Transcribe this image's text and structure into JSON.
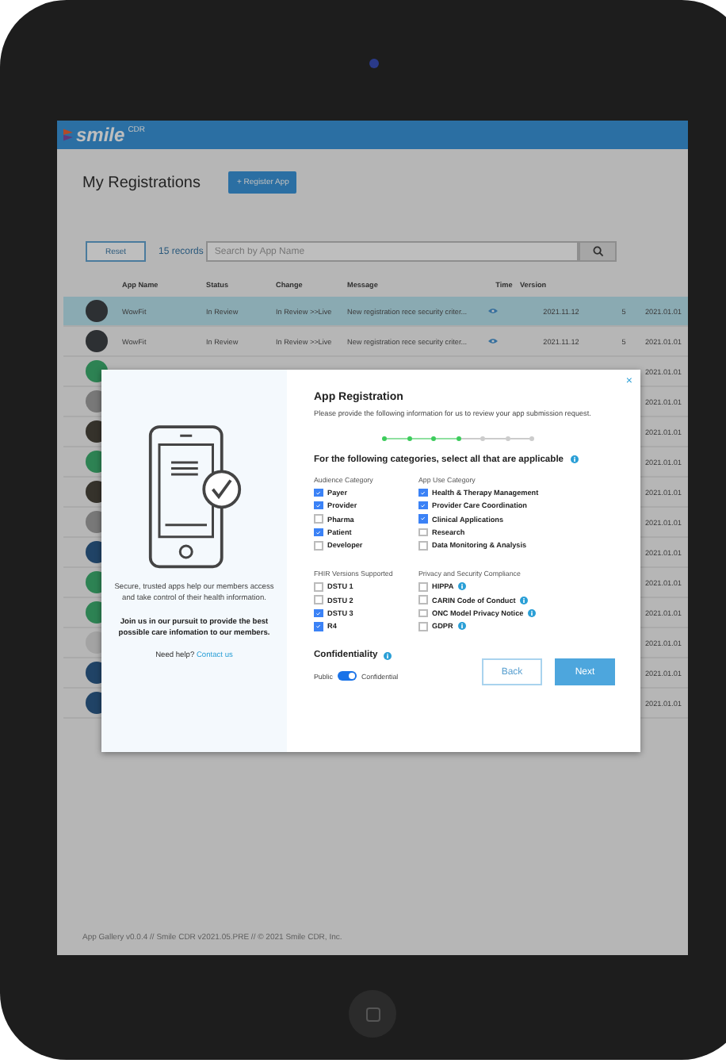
{
  "header": {
    "logo": "smile",
    "logo_suffix": "CDR"
  },
  "page": {
    "title": "My Registrations",
    "register_button": "+ Register App"
  },
  "filter": {
    "reset": "Reset",
    "count": "15 records",
    "search": {
      "placeholder": "Search by App Name"
    }
  },
  "table": {
    "columns": [
      "App Name",
      "Status",
      "Change",
      "Message",
      "Time",
      "Version"
    ],
    "rows": [
      {
        "color": "#2d3033",
        "name": "WowFit",
        "status": "In Review",
        "change": "In Review >>Live",
        "message": "New registration rece security criter...",
        "time": "2021.11.12",
        "version": "5",
        "column_7": "2021.01.01",
        "selected": true
      },
      {
        "color": "#2d3033",
        "name": "WowFit",
        "status": "In Review",
        "change": "In Review >>Live",
        "message": "New registration rece security criter...",
        "time": "2021.11.12",
        "version": "5",
        "column_7": "2021.01.01",
        "selected": false
      },
      {
        "color": "#2d8253",
        "column_7": "2021.01.01",
        "selected": false
      },
      {
        "color": "#787878",
        "column_7": "2021.01.01",
        "selected": false
      },
      {
        "color": "#35322b",
        "column_7": "2021.01.01",
        "selected": false
      },
      {
        "color": "#2d8253",
        "column_7": "2021.01.01",
        "selected": false
      },
      {
        "color": "#35322b",
        "column_7": "2021.01.01",
        "selected": false
      },
      {
        "color": "#787878",
        "column_7": "2021.01.01",
        "selected": false
      },
      {
        "color": "#204366",
        "column_7": "2021.01.01",
        "selected": false
      },
      {
        "color": "#2d8253",
        "column_7": "2021.01.01",
        "selected": false
      },
      {
        "color": "#2d8253",
        "column_7": "2021.01.01",
        "selected": false
      },
      {
        "color": "#a3a3a3",
        "column_7": "2021.01.01",
        "selected": false
      },
      {
        "color": "#204366",
        "column_7": "2021.01.01",
        "selected": false
      },
      {
        "color": "#204366",
        "column_7": "2021.01.01",
        "selected": false
      }
    ]
  },
  "footer": "App Gallery v0.0.4 // Smile CDR v2021.05.PRE // © 2021 Smile CDR, Inc.",
  "dialog": {
    "close": "×",
    "side": {
      "text": "Secure, trusted apps help our members access and take control of their health information.",
      "bold_text": "Join us in our pursuit to provide the best possible care infomation to our members.",
      "help": "Need help?",
      "link": "Contact us"
    },
    "title": "App Registration",
    "intro": "Please provide the following information for us to review your app submission request.",
    "steps": [
      {
        "done": true
      },
      {
        "done": true
      },
      {
        "done": true
      },
      {
        "done": true
      },
      {
        "done": false
      },
      {
        "done": false
      },
      {
        "done": false
      }
    ],
    "section_title": "For the following categories, select all that are applicable",
    "groups": [
      {
        "title": "Audience Category",
        "options": [
          {
            "label": "Payer",
            "checked": true,
            "info": false
          },
          {
            "label": "Provider",
            "checked": true,
            "info": false
          },
          {
            "label": "Pharma",
            "checked": false,
            "info": false
          },
          {
            "label": "Patient",
            "checked": true,
            "info": false
          },
          {
            "label": "Developer",
            "checked": false,
            "info": false
          }
        ]
      },
      {
        "title": "App Use Category",
        "options": [
          {
            "label": "Health & Therapy Management",
            "checked": true,
            "info": false
          },
          {
            "label": "Provider Care Coordination",
            "checked": true,
            "info": false
          },
          {
            "label": "Clinical Applications",
            "checked": true,
            "info": false
          },
          {
            "label": "Research",
            "checked": false,
            "info": false
          },
          {
            "label": "Data Monitoring & Analysis",
            "checked": false,
            "info": false
          }
        ]
      },
      {
        "title": "FHIR Versions Supported",
        "options": [
          {
            "label": "DSTU 1",
            "checked": false,
            "info": false
          },
          {
            "label": "DSTU 2",
            "checked": false,
            "info": false
          },
          {
            "label": "DSTU 3",
            "checked": true,
            "info": false
          },
          {
            "label": "R4",
            "checked": true,
            "info": false
          }
        ]
      },
      {
        "title": "Privacy and Security Compliance",
        "options": [
          {
            "label": "HIPPA",
            "checked": false,
            "info": true
          },
          {
            "label": "CARIN Code of Conduct",
            "checked": false,
            "info": true
          },
          {
            "label": "ONC Model Privacy Notice",
            "checked": false,
            "info": true
          },
          {
            "label": "GDPR",
            "checked": false,
            "info": true
          }
        ]
      }
    ],
    "confidentiality": {
      "title": "Confidentiality",
      "left_label": "Public",
      "right_label": "Confidential",
      "on": true
    },
    "buttons": {
      "back": "Back",
      "next": "Next"
    }
  }
}
